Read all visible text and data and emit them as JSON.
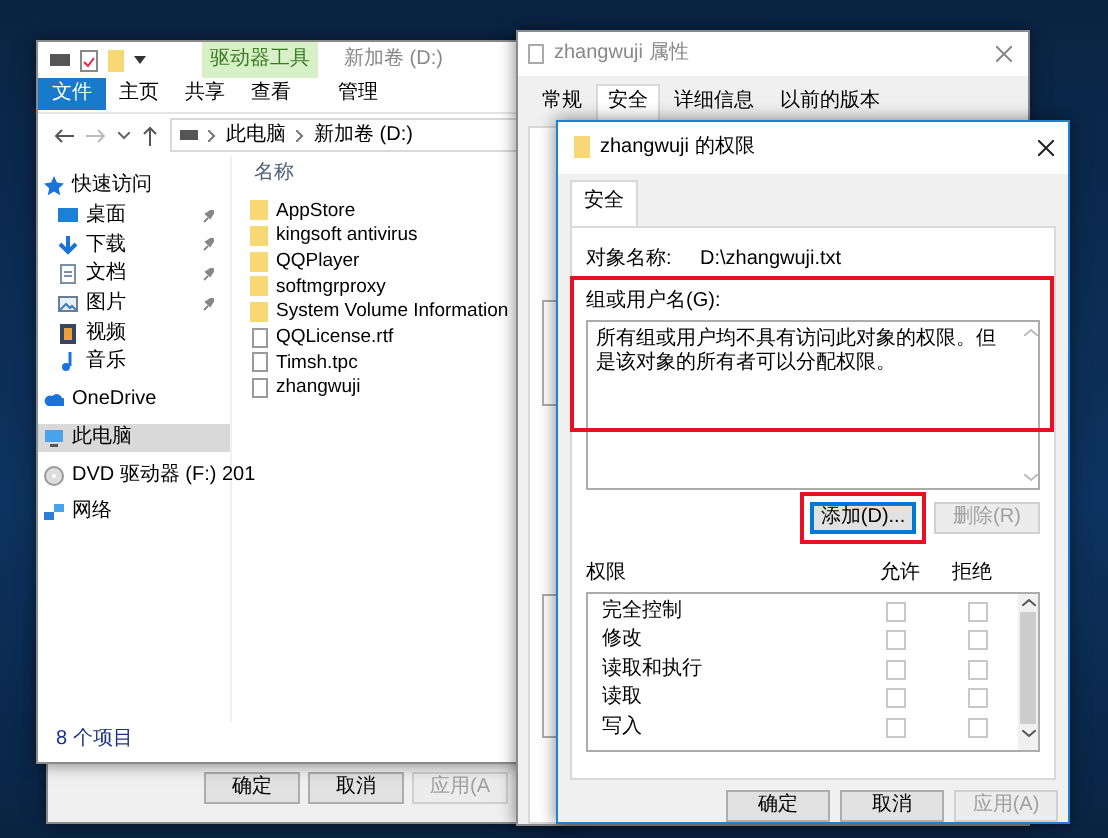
{
  "back_dialog": {
    "buttons": [
      {
        "label": "确定",
        "disabled": false
      },
      {
        "label": "取消",
        "disabled": false
      },
      {
        "label": "应用(A",
        "disabled": true
      }
    ]
  },
  "explorer": {
    "title": "新加卷 (D:)",
    "tool_tab": "驱动器工具",
    "ribbon_tabs": [
      {
        "label": "文件",
        "kind": "file"
      },
      {
        "label": "主页",
        "kind": "plain"
      },
      {
        "label": "共享",
        "kind": "plain"
      },
      {
        "label": "查看",
        "kind": "plain"
      },
      {
        "label": "管理",
        "kind": "tool"
      }
    ],
    "breadcrumb": [
      "此电脑",
      "新加卷 (D:)"
    ],
    "nav": [
      {
        "label": "快速访问",
        "kind": "star",
        "pinned": false,
        "selected": false,
        "group": true
      },
      {
        "label": "桌面",
        "kind": "desktop",
        "pinned": true,
        "selected": false,
        "group": false
      },
      {
        "label": "下载",
        "kind": "download",
        "pinned": true,
        "selected": false,
        "group": false
      },
      {
        "label": "文档",
        "kind": "document",
        "pinned": true,
        "selected": false,
        "group": false
      },
      {
        "label": "图片",
        "kind": "picture",
        "pinned": true,
        "selected": false,
        "group": false
      },
      {
        "label": "视频",
        "kind": "video",
        "pinned": false,
        "selected": false,
        "group": false
      },
      {
        "label": "音乐",
        "kind": "music",
        "pinned": false,
        "selected": false,
        "group": false
      },
      {
        "label": "OneDrive",
        "kind": "cloud",
        "pinned": false,
        "selected": false,
        "group": true
      },
      {
        "label": "此电脑",
        "kind": "computer",
        "pinned": false,
        "selected": true,
        "group": true
      },
      {
        "label": "DVD 驱动器 (F:) 201",
        "kind": "disc",
        "pinned": false,
        "selected": false,
        "group": true
      },
      {
        "label": "网络",
        "kind": "network",
        "pinned": false,
        "selected": false,
        "group": true
      }
    ],
    "column": "名称",
    "files": [
      {
        "name": "AppStore",
        "kind": "folder"
      },
      {
        "name": "kingsoft antivirus",
        "kind": "folder"
      },
      {
        "name": "QQPlayer",
        "kind": "folder"
      },
      {
        "name": "softmgrproxy",
        "kind": "folder"
      },
      {
        "name": "System Volume Information",
        "kind": "folder"
      },
      {
        "name": "QQLicense.rtf",
        "kind": "file"
      },
      {
        "name": "Timsh.tpc",
        "kind": "file"
      },
      {
        "name": "zhangwuji",
        "kind": "file"
      }
    ],
    "status": "8 个项目"
  },
  "properties": {
    "title": "zhangwuji 属性",
    "tabs": [
      {
        "label": "常规",
        "selected": false
      },
      {
        "label": "安全",
        "selected": true
      },
      {
        "label": "详细信息",
        "selected": false
      },
      {
        "label": "以前的版本",
        "selected": false
      }
    ]
  },
  "permissions": {
    "title": "zhangwuji 的权限",
    "tab": "安全",
    "object_label": "对象名称:",
    "object_value": "D:\\zhangwuji.txt",
    "group_label": "组或用户名(G):",
    "group_highlighted": true,
    "group_message": "所有组或用户均不具有访问此对象的权限。但是该对象的所有者可以分配权限。",
    "buttons": [
      {
        "label": "添加(D)...",
        "disabled": false,
        "focused": true,
        "highlighted": true
      },
      {
        "label": "删除(R)",
        "disabled": true,
        "focused": false,
        "highlighted": false
      }
    ],
    "perm_header": [
      "权限",
      "允许",
      "拒绝"
    ],
    "perms": [
      {
        "name": "完全控制",
        "allow": false,
        "deny": false
      },
      {
        "name": "修改",
        "allow": false,
        "deny": false
      },
      {
        "name": "读取和执行",
        "allow": false,
        "deny": false
      },
      {
        "name": "读取",
        "allow": false,
        "deny": false
      },
      {
        "name": "写入",
        "allow": false,
        "deny": false
      }
    ],
    "footer_buttons": [
      {
        "label": "确定",
        "disabled": false
      },
      {
        "label": "取消",
        "disabled": false
      },
      {
        "label": "应用(A)",
        "disabled": true
      }
    ]
  }
}
